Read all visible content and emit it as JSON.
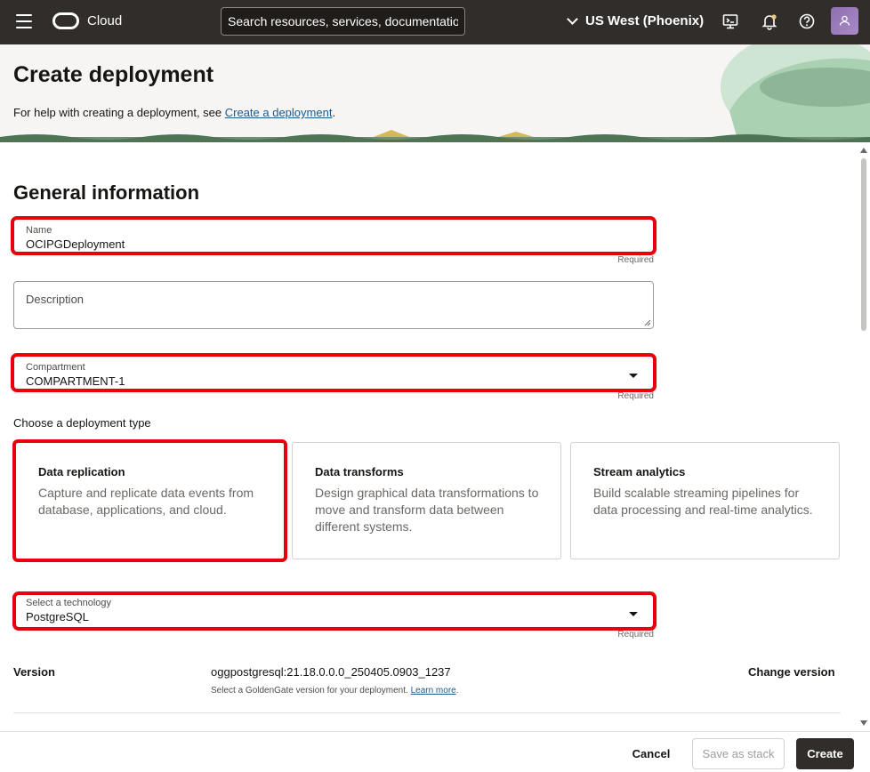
{
  "topbar": {
    "brand": "Cloud",
    "search_placeholder": "Search resources, services, documentation",
    "region": "US West (Phoenix)"
  },
  "header": {
    "title": "Create deployment",
    "help_prefix": "For help with creating a deployment, see ",
    "help_link": "Create a deployment",
    "help_suffix": "."
  },
  "general": {
    "section_title": "General information",
    "name_label": "Name",
    "name_value": "OCIPGDeployment",
    "required": "Required",
    "description_label": "Description",
    "compartment_label": "Compartment",
    "compartment_value": "COMPARTMENT-1",
    "type_label": "Choose a deployment type",
    "cards": [
      {
        "title": "Data replication",
        "desc": "Capture and replicate data events from database, applications, and cloud."
      },
      {
        "title": "Data transforms",
        "desc": "Design graphical data transformations to move and transform data between different systems."
      },
      {
        "title": "Stream analytics",
        "desc": "Build scalable streaming pipelines for data processing and real-time analytics."
      }
    ],
    "technology_label": "Select a technology",
    "technology_value": "PostgreSQL",
    "version_label": "Version",
    "version_value": "oggpostgresql:21.18.0.0.0_250405.0903_1237",
    "version_help": "Select a GoldenGate version for your deployment. ",
    "version_help_link": "Learn more",
    "version_help_suffix": ".",
    "change_version": "Change version"
  },
  "footer": {
    "cancel": "Cancel",
    "save_stack": "Save as stack",
    "create": "Create"
  },
  "colors": {
    "topbar": "#312d2a",
    "highlight": "#e8000d",
    "link": "#1a5b91"
  }
}
